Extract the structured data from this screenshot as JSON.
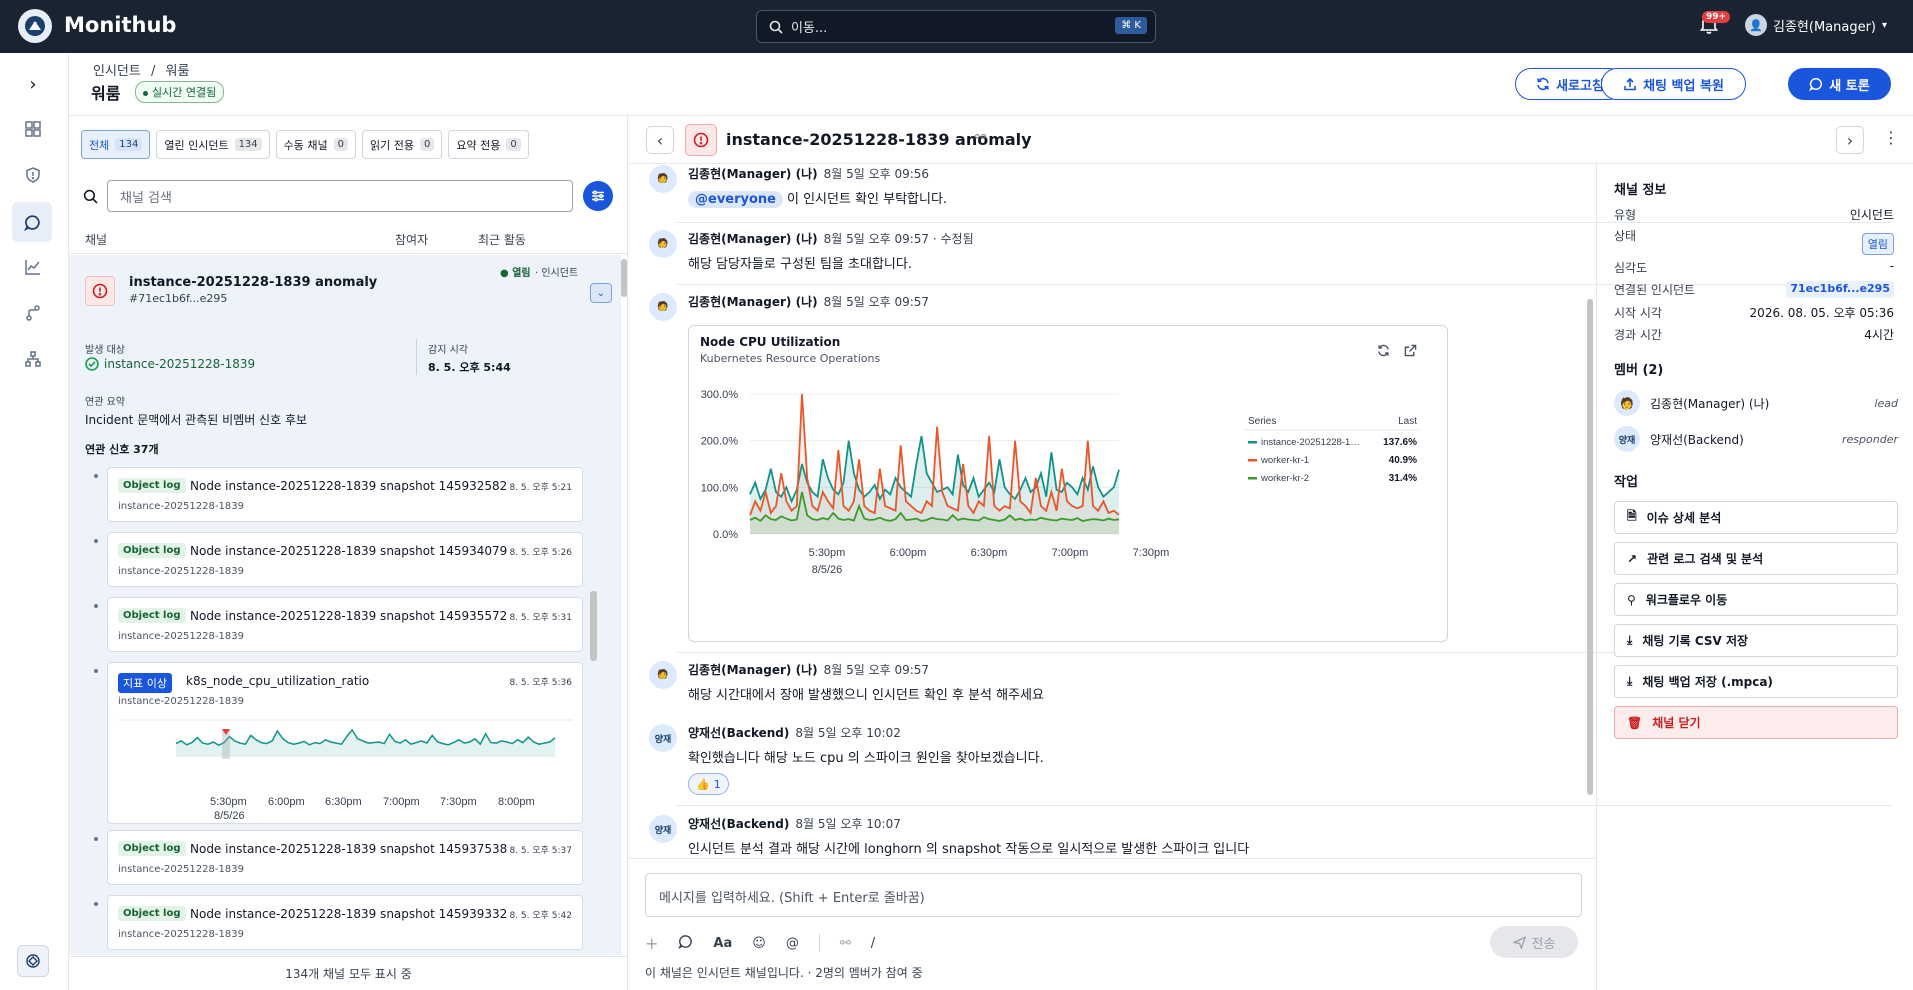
{
  "app": {
    "name": "Monithub",
    "search_placeholder": "이동...",
    "search_kbd": "⌘ K",
    "notif_badge": "99+",
    "user": "김종현(Manager)"
  },
  "header": {
    "breadcrumb_1": "인시던트",
    "breadcrumb_sep": "/",
    "breadcrumb_2": "워룸",
    "title": "워룸",
    "live": "실시간 연결됨",
    "btn_refresh": "새로고침",
    "btn_restore": "채팅 백업 복원",
    "btn_new": "새 토론"
  },
  "filters": [
    {
      "label": "전체",
      "count": "134"
    },
    {
      "label": "열린 인시던트",
      "count": "134"
    },
    {
      "label": "수동 채널",
      "count": "0"
    },
    {
      "label": "읽기 전용",
      "count": "0"
    },
    {
      "label": "요약 전용",
      "count": "0"
    }
  ],
  "list": {
    "search_placeholder": "채널 검색",
    "col_channel": "채널",
    "col_members": "참여자",
    "col_activity": "최근 활동",
    "footer": "134개 채널 모두 표시 중",
    "card": {
      "title": "instance-20251228-1839 anomaly",
      "id": "#71ec1b6f...e295",
      "status": "열림",
      "kind": "인시던트",
      "target_label": "발생 대상",
      "target": "instance-20251228-1839",
      "detect_label": "감지 시각",
      "detect": "8. 5. 오후 5:44",
      "summary_label": "연관 요약",
      "summary": "Incident 문맥에서 관측된 비멤버 신호 후보",
      "signals_label": "연관 신호 37개"
    },
    "signals": [
      {
        "tag": "Object log",
        "title": "Node instance-20251228-1839 snapshot 145932582",
        "sub": "instance-20251228-1839",
        "time": "8. 5. 오후 5:21"
      },
      {
        "tag": "Object log",
        "title": "Node instance-20251228-1839 snapshot 145934079",
        "sub": "instance-20251228-1839",
        "time": "8. 5. 오후 5:26"
      },
      {
        "tag": "Object log",
        "title": "Node instance-20251228-1839 snapshot 145935572",
        "sub": "instance-20251228-1839",
        "time": "8. 5. 오후 5:31"
      },
      {
        "tag": "지표 이상",
        "title": "k8s_node_cpu_utilization_ratio",
        "sub": "instance-20251228-1839",
        "time": "8. 5. 오후 5:36"
      },
      {
        "tag": "Object log",
        "title": "Node instance-20251228-1839 snapshot 145937538",
        "sub": "instance-20251228-1839",
        "time": "8. 5. 오후 5:37"
      },
      {
        "tag": "Object log",
        "title": "Node instance-20251228-1839 snapshot 145939332",
        "sub": "instance-20251228-1839",
        "time": "8. 5. 오후 5:42"
      }
    ],
    "mini_ticks": [
      "5:30pm",
      "6:00pm",
      "6:30pm",
      "7:00pm",
      "7:30pm",
      "8:00pm"
    ],
    "mini_date": "8/5/26"
  },
  "chat": {
    "title": "instance-20251228-1839 anomaly",
    "messages": [
      {
        "author": "김종현(Manager) (나)",
        "time": "8월 5일 오후 09:56",
        "mention": "@everyone",
        "text": "이 인시던트 확인 부탁합니다."
      },
      {
        "author": "김종현(Manager) (나)",
        "time": "8월 5일 오후 09:57 · 수정됨",
        "text": "해당 담당자들로 구성된 팀을 초대합니다."
      },
      {
        "author": "김종현(Manager) (나)",
        "time": "8월 5일 오후 09:57",
        "text": ""
      },
      {
        "author": "김종현(Manager) (나)",
        "time": "8월 5일 오후 09:57",
        "text": "해당 시간대에서 장애 발생했으니 인시던트 확인 후 분석 해주세요"
      },
      {
        "author": "양재선(Backend)",
        "time": "8월 5일 오후 10:02",
        "text": "확인했습니다 해당 노드 cpu 의 스파이크 원인을 찾아보겠습니다.",
        "reaction": "1"
      },
      {
        "author": "양재선(Backend)",
        "time": "8월 5일 오후 10:07",
        "text": "인시던트 분석 결과 해당 시간에 longhorn 의 snapshot 작동으로 일시적으로 발생한 스파이크 입니다"
      }
    ],
    "avatar_initials": "양재",
    "composer_placeholder": "메시지를 입력하세요. (Shift + Enter로 줄바꿈)",
    "send": "전송",
    "footer": "이 채널은 인시던트 채널입니다. · 2명의 멤버가 참여 중",
    "tool_font": "Aa"
  },
  "chart_data": {
    "type": "line",
    "title": "Node CPU Utilization",
    "subtitle": "Kubernetes Resource Operations",
    "y_ticks": [
      "300.0%",
      "200.0%",
      "100.0%",
      "0.0%"
    ],
    "ylim": [
      0,
      300
    ],
    "x_ticks": [
      "5:30pm",
      "6:00pm",
      "6:30pm",
      "7:00pm",
      "7:30pm"
    ],
    "x_date": "8/5/26",
    "legend_header": [
      "Series",
      "Last"
    ],
    "grid": true,
    "series": [
      {
        "name": "instance-20251228-1…",
        "last": "137.6%",
        "color": "#12938a",
        "values": [
          85,
          110,
          75,
          95,
          140,
          90,
          80,
          100,
          70,
          95,
          150,
          110,
          90,
          80,
          160,
          120,
          95,
          85,
          110,
          200,
          130,
          95,
          80,
          90,
          105,
          75,
          95,
          85,
          120,
          100,
          90,
          80,
          150,
          210,
          130,
          110,
          90,
          95,
          100,
          85,
          170,
          105,
          90,
          120,
          80,
          95,
          110,
          90,
          160,
          100,
          85,
          75,
          95,
          120,
          90,
          100,
          130,
          80,
          175,
          95,
          90,
          110,
          100,
          85,
          120,
          95,
          145,
          100,
          80,
          90,
          100,
          137.6
        ]
      },
      {
        "name": "worker-kr-1",
        "last": "40.9%",
        "color": "#e8562a",
        "values": [
          40,
          70,
          50,
          90,
          45,
          60,
          130,
          70,
          50,
          60,
          300,
          120,
          60,
          50,
          90,
          70,
          55,
          180,
          60,
          50,
          70,
          160,
          60,
          50,
          45,
          140,
          60,
          55,
          50,
          190,
          70,
          60,
          50,
          45,
          70,
          60,
          230,
          90,
          60,
          55,
          50,
          150,
          60,
          45,
          70,
          60,
          210,
          60,
          50,
          60,
          55,
          200,
          70,
          60,
          45,
          120,
          60,
          50,
          90,
          50,
          140,
          70,
          60,
          55,
          60,
          200,
          60,
          50,
          70,
          45,
          50,
          40.9
        ]
      },
      {
        "name": "worker-kr-2",
        "last": "31.4%",
        "color": "#3d9a2c",
        "values": [
          30,
          35,
          28,
          40,
          32,
          30,
          38,
          33,
          29,
          31,
          90,
          40,
          32,
          30,
          34,
          31,
          45,
          33,
          30,
          32,
          29,
          60,
          33,
          30,
          31,
          35,
          30,
          28,
          32,
          45,
          30,
          31,
          33,
          28,
          30,
          35,
          32,
          31,
          29,
          40,
          30,
          33,
          31,
          30,
          29,
          36,
          32,
          30,
          28,
          31,
          40,
          30,
          33,
          29,
          31,
          30,
          35,
          32,
          30,
          29,
          33,
          31,
          30,
          34,
          28,
          30,
          32,
          31,
          29,
          33,
          30,
          31.4
        ]
      }
    ]
  },
  "info": {
    "channel_info": "채널 정보",
    "rows": [
      {
        "k": "유형",
        "v": "인시던트"
      },
      {
        "k": "상태",
        "v": "열림"
      },
      {
        "k": "심각도",
        "v": "-"
      },
      {
        "k": "연결된 인시던트",
        "v": "71ec1b6f...e295"
      },
      {
        "k": "시작 시각",
        "v": "2026. 08. 05. 오후 05:36"
      },
      {
        "k": "경과 시간",
        "v": "4시간"
      }
    ],
    "members_title": "멤버 (2)",
    "members": [
      {
        "name": "김종현(Manager) (나)",
        "role": "lead"
      },
      {
        "name": "양재선(Backend)",
        "role": "responder"
      }
    ],
    "actions_title": "작업",
    "actions": [
      "이슈 상세 분석",
      "관련 로그 검색 및 분석",
      "워크플로우 이동",
      "채팅 기록 CSV 저장",
      "채팅 백업 저장 (.mpca)",
      "채널 닫기"
    ]
  }
}
